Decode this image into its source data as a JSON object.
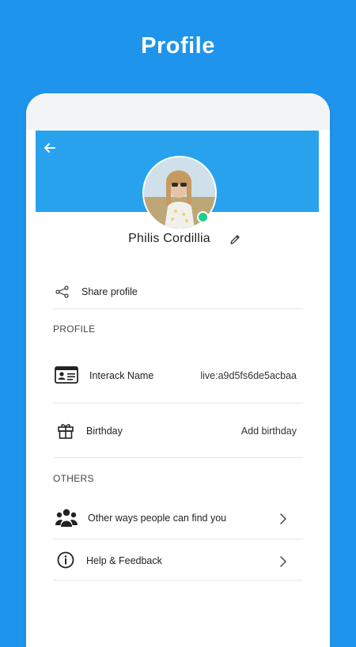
{
  "promo": {
    "title": "Profile"
  },
  "header": {
    "accent": "#29a2ee"
  },
  "profile": {
    "name": "Philis Cordillia",
    "status_color": "#1fcf8e"
  },
  "actions": {
    "share_label": "Share profile"
  },
  "sections": {
    "profile_title": "PROFILE",
    "others_title": "OTHERS"
  },
  "profile_items": [
    {
      "label": "Interack Name",
      "value": "live:a9d5fs6de5acbaa",
      "icon": "id-card-icon"
    },
    {
      "label": "Birthday",
      "value": "Add  birthday",
      "icon": "gift-icon"
    }
  ],
  "others_items": [
    {
      "label": "Other ways people can find you",
      "icon": "people-icon"
    },
    {
      "label": "Help & Feedback",
      "icon": "info-icon"
    }
  ]
}
